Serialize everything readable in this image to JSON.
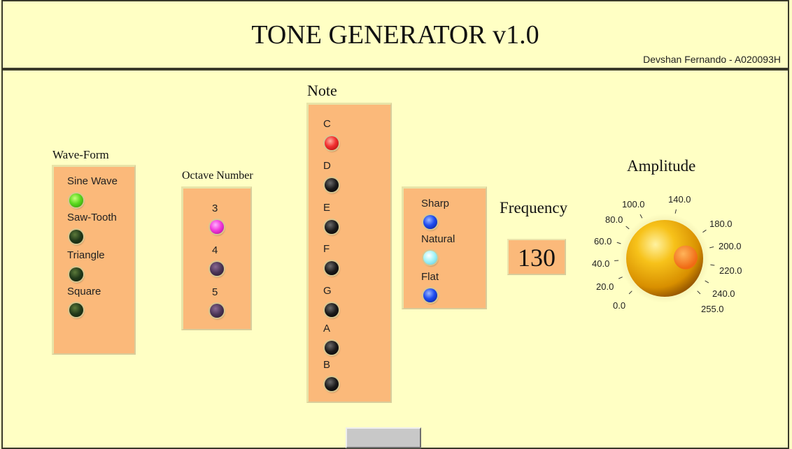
{
  "header": {
    "title": "TONE GENERATOR v1.0",
    "author": "Devshan Fernando - A020093H"
  },
  "waveform": {
    "label": "Wave-Form",
    "options": [
      {
        "label": "Sine Wave",
        "state": "on",
        "color": "#5ad91e"
      },
      {
        "label": "Saw-Tooth",
        "state": "off",
        "color": "#21391a"
      },
      {
        "label": "Triangle",
        "state": "off",
        "color": "#21391a"
      },
      {
        "label": "Square",
        "state": "off",
        "color": "#21391a"
      }
    ]
  },
  "octave": {
    "label": "Octave Number",
    "options": [
      {
        "label": "3",
        "state": "on",
        "color": "#f23cdc"
      },
      {
        "label": "4",
        "state": "off",
        "color": "#4a3456"
      },
      {
        "label": "5",
        "state": "off",
        "color": "#4a3456"
      }
    ]
  },
  "note": {
    "label": "Note",
    "options": [
      {
        "label": "C",
        "state": "on",
        "color": "#f23030"
      },
      {
        "label": "D",
        "state": "off",
        "color": "#1a1a1a"
      },
      {
        "label": "E",
        "state": "off",
        "color": "#1a1a1a"
      },
      {
        "label": "F",
        "state": "off",
        "color": "#1a1a1a"
      },
      {
        "label": "G",
        "state": "off",
        "color": "#1a1a1a"
      },
      {
        "label": "A",
        "state": "off",
        "color": "#1a1a1a"
      },
      {
        "label": "B",
        "state": "off",
        "color": "#1a1a1a"
      }
    ]
  },
  "accidental": {
    "options": [
      {
        "label": "Sharp",
        "state": "off",
        "color": "#1e4cf0"
      },
      {
        "label": "Natural",
        "state": "on",
        "color": "#a6f4f8"
      },
      {
        "label": "Flat",
        "state": "off",
        "color": "#1e4cf0"
      }
    ]
  },
  "frequency": {
    "label": "Frequency",
    "value": "130"
  },
  "amplitude": {
    "label": "Amplitude",
    "value": 210,
    "scale_min": 0,
    "scale_max": 255,
    "ticks": [
      "0.0",
      "20.0",
      "40.0",
      "60.0",
      "80.0",
      "100.0",
      "140.0",
      "180.0",
      "200.0",
      "220.0",
      "240.0",
      "255.0"
    ]
  },
  "colors": {
    "background": "#ffffc4",
    "panel": "#fbb97a",
    "knob": "#f5b800"
  }
}
